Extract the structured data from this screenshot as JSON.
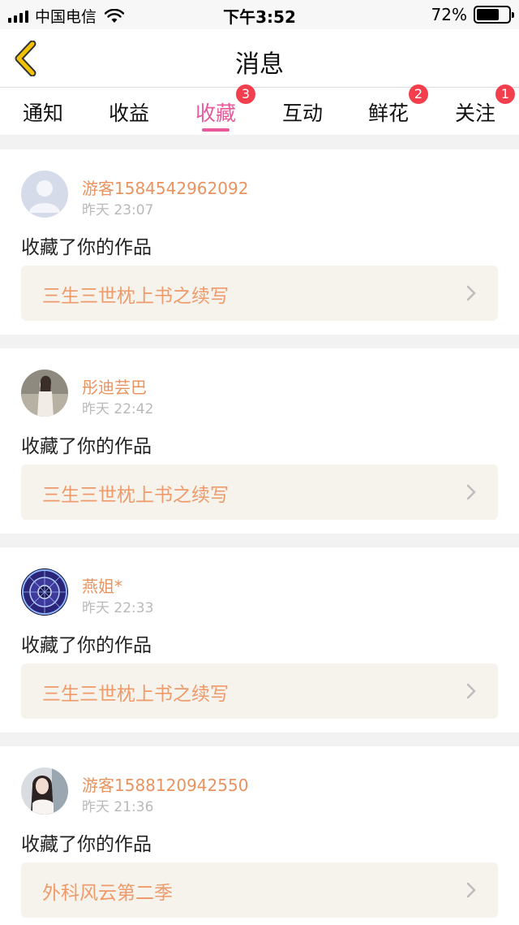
{
  "status_bar": {
    "carrier": "中国电信",
    "time": "下午3:52",
    "battery": "72%",
    "battery_level": 0.72
  },
  "nav": {
    "title": "消息",
    "back_icon": "chevron-left-icon"
  },
  "tabs": [
    {
      "label": "通知",
      "badge": null,
      "active": false
    },
    {
      "label": "收益",
      "badge": null,
      "active": false
    },
    {
      "label": "收藏",
      "badge": "3",
      "active": true
    },
    {
      "label": "互动",
      "badge": null,
      "active": false
    },
    {
      "label": "鲜花",
      "badge": "2",
      "active": false
    },
    {
      "label": "关注",
      "badge": "1",
      "active": false
    }
  ],
  "colors": {
    "accent": "#e8589b",
    "username": "#e8935f",
    "work_title": "#ef9a6a",
    "badge": "#f33e4e",
    "back_icon": "#f2c200"
  },
  "messages": [
    {
      "username": "游客1584542962092",
      "time": "昨天 23:07",
      "action": "收藏了你的作品",
      "work": "三生三世枕上书之续写",
      "avatar": "default-avatar-icon"
    },
    {
      "username": "彤迪芸巴",
      "time": "昨天 22:42",
      "action": "收藏了你的作品",
      "work": "三生三世枕上书之续写",
      "avatar": "user-photo-avatar"
    },
    {
      "username": "燕姐*",
      "time": "昨天 22:33",
      "action": "收藏了你的作品",
      "work": "三生三世枕上书之续写",
      "avatar": "zodiac-wheel-avatar"
    },
    {
      "username": "游客1588120942550",
      "time": "昨天 21:36",
      "action": "收藏了你的作品",
      "work": "外科风云第二季",
      "avatar": "user-photo-avatar"
    }
  ]
}
